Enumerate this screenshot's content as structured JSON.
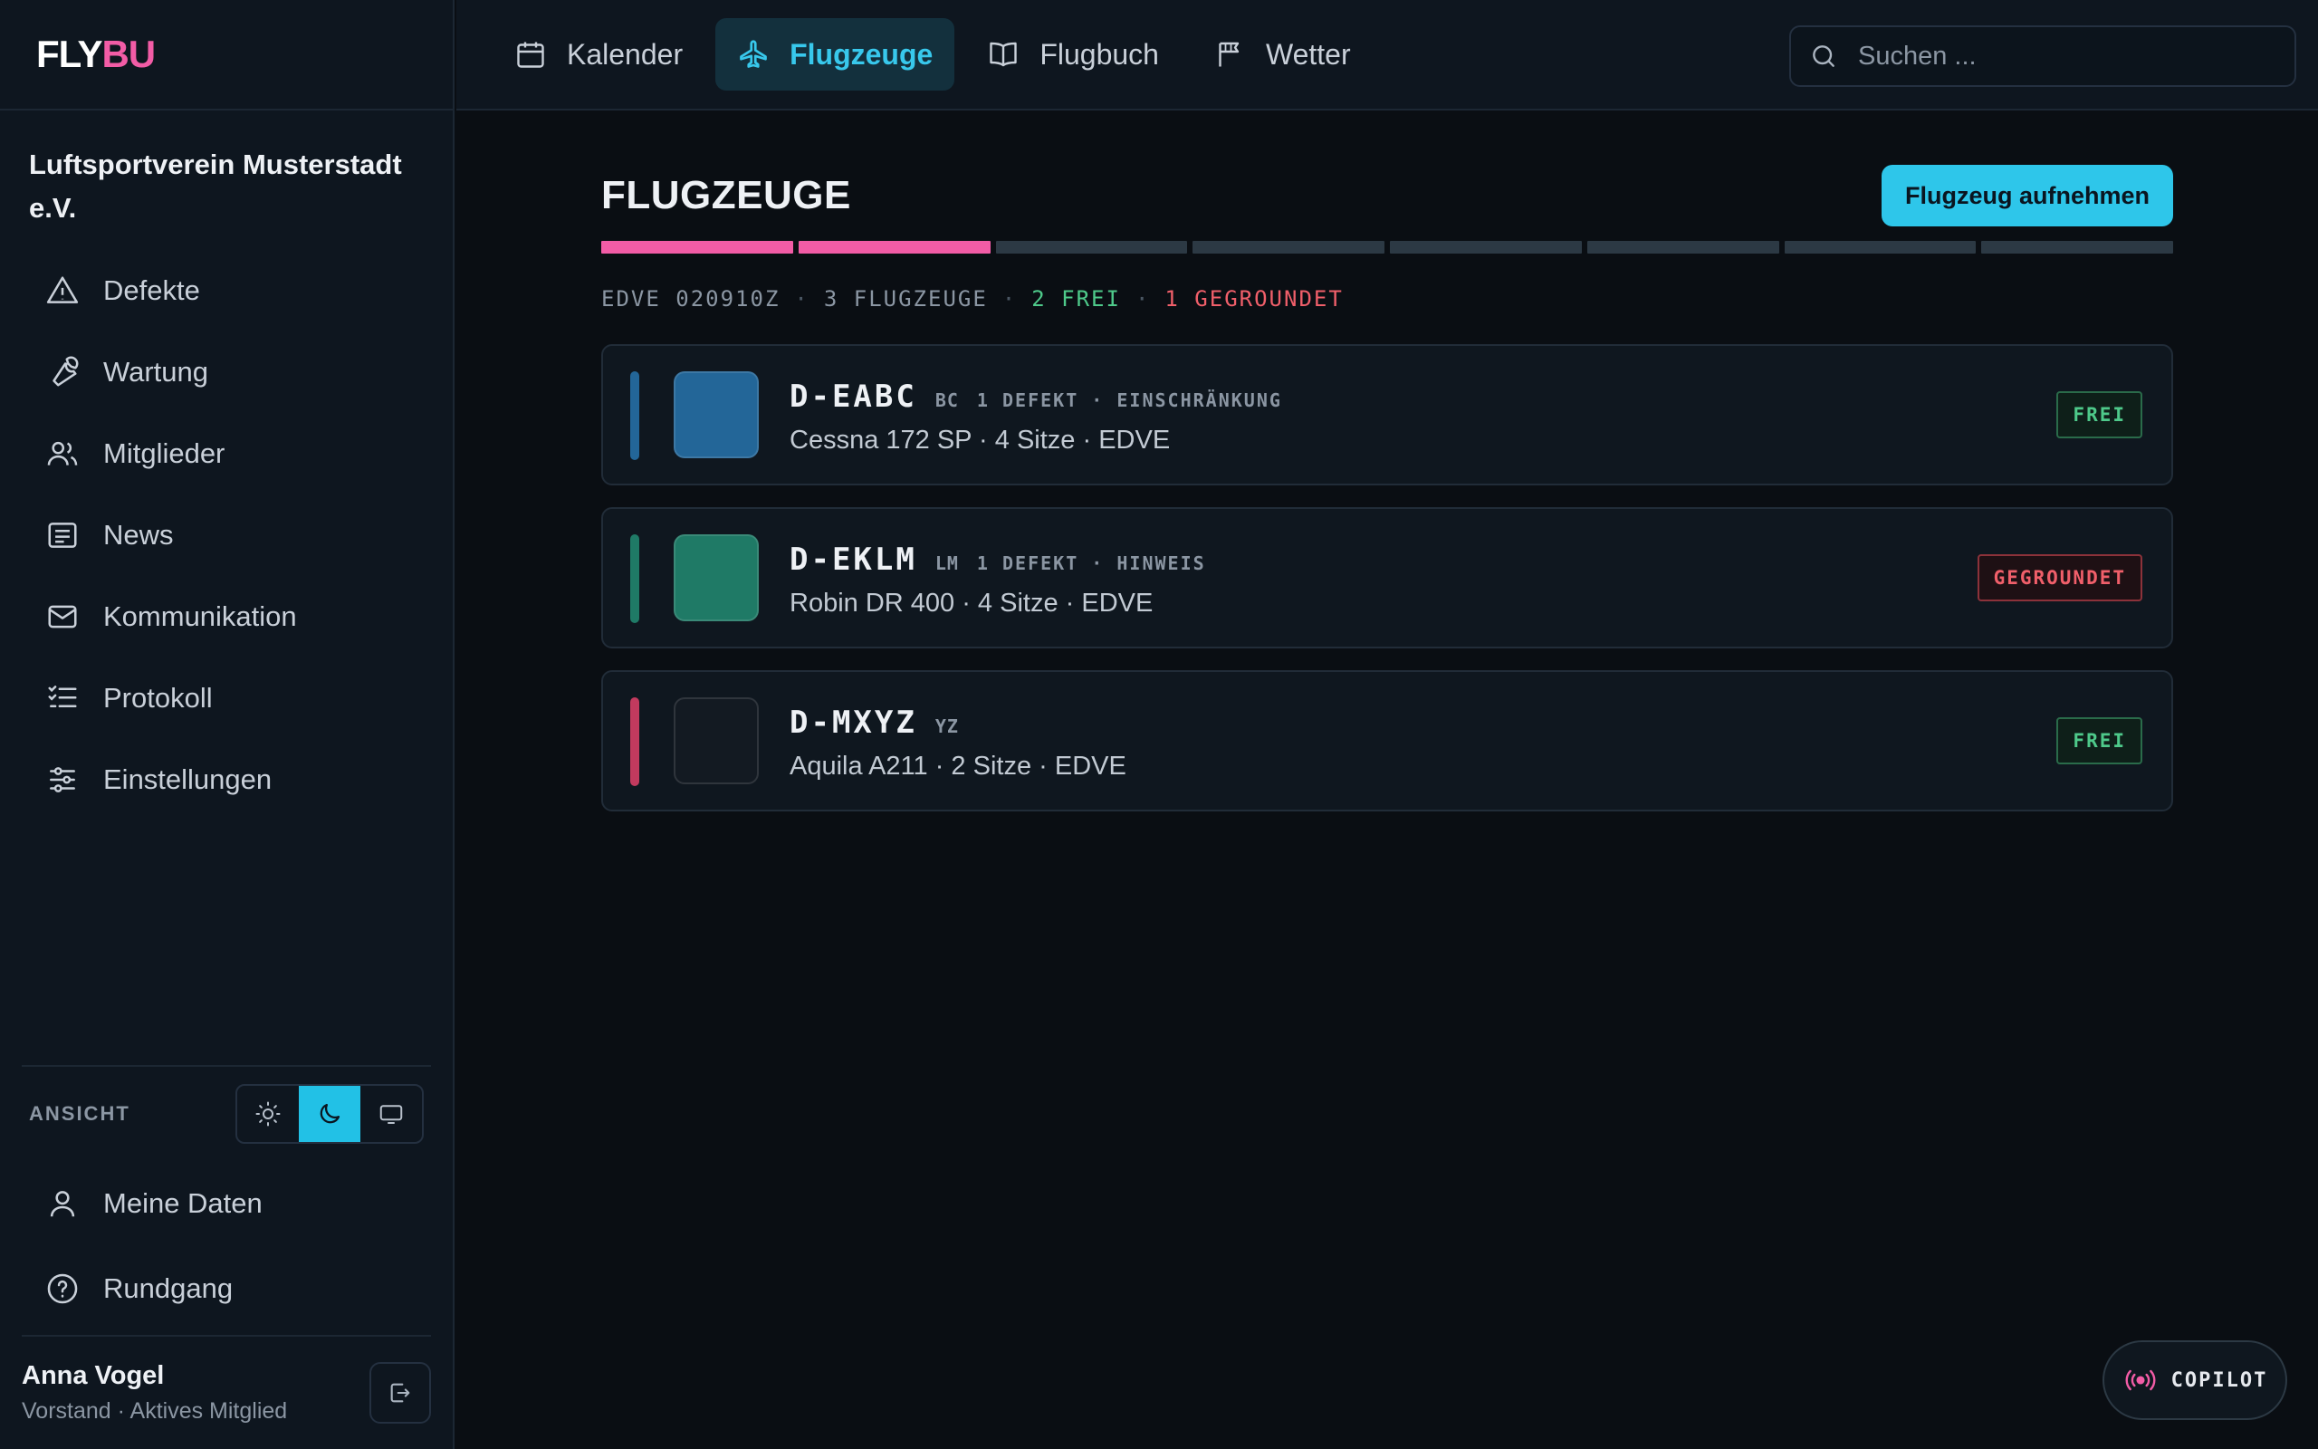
{
  "app": {
    "logo_a": "FLY",
    "logo_b": "BU",
    "club_name": "Luftsportverein Musterstadt e.V."
  },
  "sidebar": {
    "items": [
      {
        "label": "Defekte",
        "icon": "warning-icon"
      },
      {
        "label": "Wartung",
        "icon": "wrench-icon"
      },
      {
        "label": "Mitglieder",
        "icon": "users-icon"
      },
      {
        "label": "News",
        "icon": "newspaper-icon"
      },
      {
        "label": "Kommunikation",
        "icon": "mail-icon"
      },
      {
        "label": "Protokoll",
        "icon": "list-check-icon"
      },
      {
        "label": "Einstellungen",
        "icon": "sliders-icon"
      }
    ],
    "view_label": "ANSICHT",
    "view_modes": [
      "light",
      "dark",
      "system"
    ],
    "view_active": "dark",
    "my_data": "Meine Daten",
    "tour": "Rundgang",
    "user": {
      "name": "Anna Vogel",
      "role": "Vorstand · Aktives Mitglied"
    }
  },
  "topbar": {
    "tabs": [
      {
        "label": "Kalender",
        "icon": "calendar-icon",
        "active": false
      },
      {
        "label": "Flugzeuge",
        "icon": "plane-icon",
        "active": true
      },
      {
        "label": "Flugbuch",
        "icon": "book-icon",
        "active": false
      },
      {
        "label": "Wetter",
        "icon": "flag-icon",
        "active": false
      }
    ],
    "search_placeholder": "Suchen ..."
  },
  "main": {
    "title": "FLUGZEUGE",
    "add_button": "Flugzeug aufnehmen",
    "progress": {
      "total": 8,
      "filled": 2,
      "color": "#f25ca6"
    },
    "status": {
      "station": "EDVE 020910Z",
      "count": "3 FLUGZEUGE",
      "free": "2 FREI",
      "grounded": "1 GEGROUNDET"
    },
    "aircraft": [
      {
        "registration": "D-EABC",
        "code": "BC",
        "defect": "1 DEFEKT · EINSCHRÄNKUNG",
        "description": "Cessna 172 SP · 4 Sitze · EDVE",
        "status": "FREI",
        "status_kind": "free",
        "color": "#236698"
      },
      {
        "registration": "D-EKLM",
        "code": "LM",
        "defect": "1 DEFEKT · HINWEIS",
        "description": "Robin DR 400 · 4 Sitze · EDVE",
        "status": "GEGROUNDET",
        "status_kind": "ground",
        "color": "#1f7a66"
      },
      {
        "registration": "D-MXYZ",
        "code": "YZ",
        "defect": "",
        "description": "Aquila A211 · 2 Sitze · EDVE",
        "status": "FREI",
        "status_kind": "free",
        "color": "#c23a5e",
        "swatch_color": "#131a22"
      }
    ]
  },
  "copilot": {
    "label": "COPILOT",
    "icon": "broadcast-icon"
  }
}
